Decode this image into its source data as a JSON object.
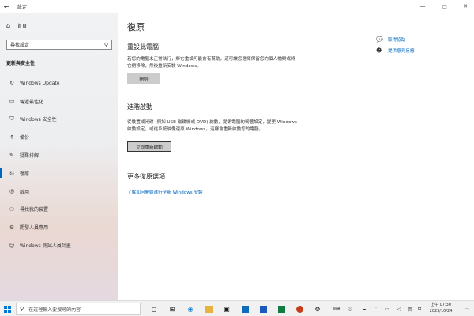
{
  "window": {
    "title": "設定",
    "back_glyph": "←",
    "controls": {
      "minimize": "—",
      "maximize": "□",
      "close": "✕"
    }
  },
  "sidebar": {
    "home_label": "首頁",
    "search_placeholder": "尋找設定",
    "section_title": "更新與安全性",
    "items": [
      {
        "label": "Windows Update",
        "icon": "refresh-icon"
      },
      {
        "label": "傳遞最佳化",
        "icon": "delivery-optimization-icon"
      },
      {
        "label": "Windows 安全性",
        "icon": "shield-icon"
      },
      {
        "label": "備份",
        "icon": "backup-arrow-icon"
      },
      {
        "label": "疑難排解",
        "icon": "wrench-icon"
      },
      {
        "label": "復原",
        "icon": "recovery-icon",
        "active": true
      },
      {
        "label": "啟用",
        "icon": "check-circle-icon"
      },
      {
        "label": "尋找我的裝置",
        "icon": "person-locate-icon"
      },
      {
        "label": "開發人員專用",
        "icon": "developer-icon"
      },
      {
        "label": "Windows 測試人員計畫",
        "icon": "insider-icon"
      }
    ]
  },
  "main": {
    "title": "復原",
    "reset": {
      "heading": "重設此電腦",
      "description": "若您的電腦未正常執行，將它重設可能會有幫助，這可讓您選擇保留您的個人檔案或將它們移除，然後重新安裝 Windows。",
      "button": "開始"
    },
    "advanced": {
      "heading": "進階啟動",
      "description": "從裝置或光碟 (例如 USB 磁碟機或 DVD) 啟動，變更電腦的韌體設定，變更 Windows 啟動設定，或從系統映像還原 Windows。這樣會重新啟動您的電腦。",
      "button": "立即重新啟動"
    },
    "more": {
      "heading": "更多復原選項",
      "link": "了解如何開始進行全新 Windows 安裝"
    },
    "help": [
      {
        "label": "取得協助",
        "icon": "help-chat-icon"
      },
      {
        "label": "提供意見反應",
        "icon": "feedback-icon"
      }
    ]
  },
  "taskbar": {
    "search_placeholder": "在這裡輸入要搜尋的內容",
    "apps": [
      {
        "icon": "task-view-icon",
        "color": "#333333"
      },
      {
        "icon": "widgets-icon",
        "color": "#333333"
      },
      {
        "icon": "edge-icon",
        "color": "#0f7fd1"
      },
      {
        "icon": "file-explorer-icon",
        "color": "#e8b53c"
      },
      {
        "icon": "store-icon",
        "color": "#333333"
      },
      {
        "icon": "mail-icon",
        "color": "#0f6cbd"
      },
      {
        "icon": "word-icon",
        "color": "#185abd"
      },
      {
        "icon": "excel-icon",
        "color": "#107c41"
      },
      {
        "icon": "powerpoint-icon",
        "color": "#c43e1c"
      },
      {
        "icon": "settings-gear-icon",
        "color": "#333333"
      }
    ],
    "tray": {
      "ime_mode": "英",
      "time": "上午 07:30",
      "date": "2023/10/24"
    }
  }
}
